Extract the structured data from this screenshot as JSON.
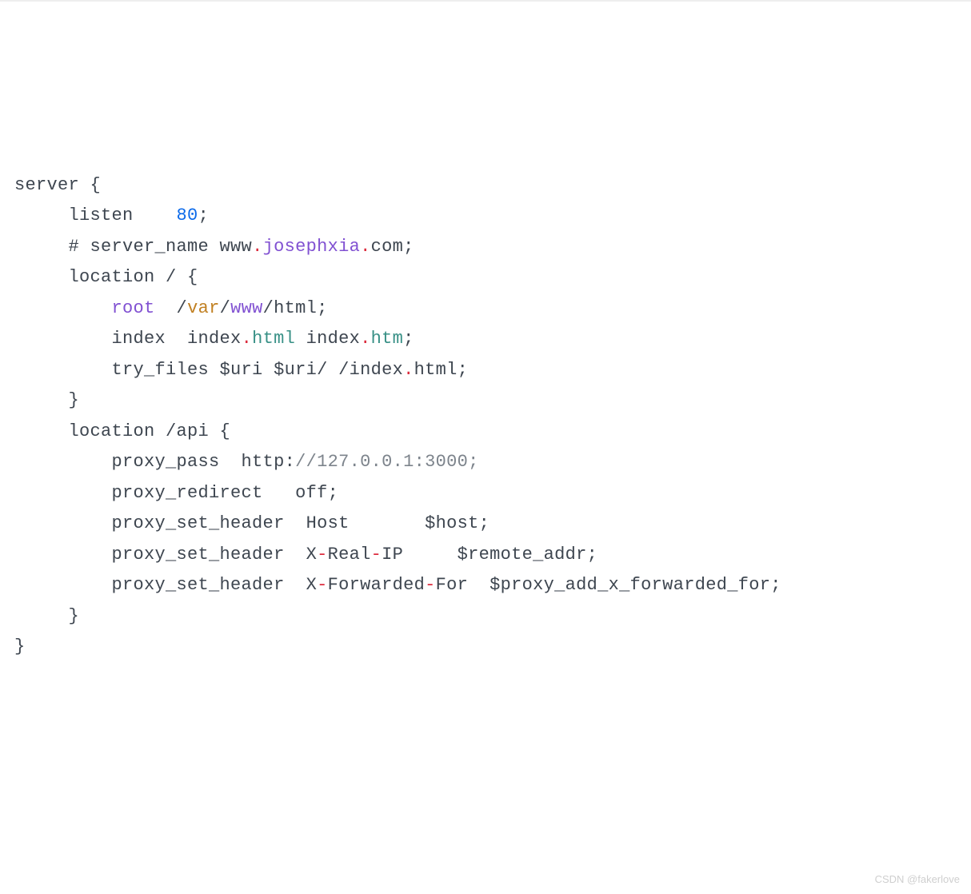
{
  "code": {
    "l1_p1": "server {",
    "l2_p1": "listen    ",
    "l2_p2": "80",
    "l2_p3": ";",
    "l3_p1": "# server_name www",
    "l3_p2": ".",
    "l3_p3": "josephxia",
    "l3_p4": ".",
    "l3_p5": "com;",
    "l4_p1": "location / {",
    "l5_p1": "root",
    "l5_p2": "  /",
    "l5_p3": "var",
    "l5_p4": "/",
    "l5_p5": "www",
    "l5_p6": "/html;",
    "l6_p1": "index  index",
    "l6_p2": ".",
    "l6_p3": "html",
    "l6_p4": " index",
    "l6_p5": ".",
    "l6_p6": "htm",
    "l6_p7": ";",
    "l7_p1": "try_files $uri $uri/ /index",
    "l7_p2": ".",
    "l7_p3": "html;",
    "l8_p1": "}",
    "l9_p1": "location /api {",
    "l10_p1": "proxy_pass  http:",
    "l10_p2": "//127.0.0.1:3000;",
    "l11_p1": "proxy_redirect   off;",
    "l12_p1": "proxy_set_header  Host       $host;",
    "l13_p1": "proxy_set_header  X",
    "l13_p2": "-",
    "l13_p3": "Real",
    "l13_p4": "-",
    "l13_p5": "IP     $remote_addr;",
    "l14_p1": "proxy_set_header  X",
    "l14_p2": "-",
    "l14_p3": "Forwarded",
    "l14_p4": "-",
    "l14_p5": "For  $proxy_add_x_forwarded_for;",
    "l15_p1": "}",
    "l16_p1": "}"
  },
  "watermark": "CSDN @fakerlove"
}
